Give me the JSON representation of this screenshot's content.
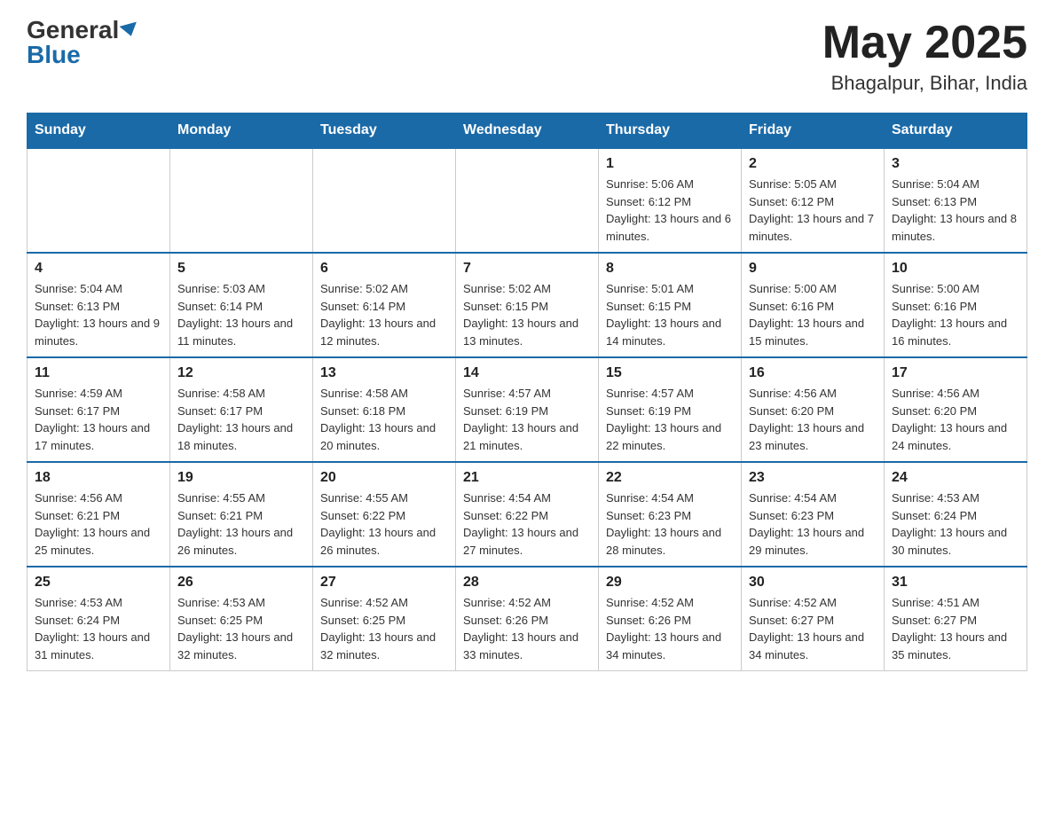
{
  "header": {
    "logo_general": "General",
    "logo_blue": "Blue",
    "month_year": "May 2025",
    "location": "Bhagalpur, Bihar, India"
  },
  "days_of_week": [
    "Sunday",
    "Monday",
    "Tuesday",
    "Wednesday",
    "Thursday",
    "Friday",
    "Saturday"
  ],
  "weeks": [
    [
      {
        "day": "",
        "info": ""
      },
      {
        "day": "",
        "info": ""
      },
      {
        "day": "",
        "info": ""
      },
      {
        "day": "",
        "info": ""
      },
      {
        "day": "1",
        "info": "Sunrise: 5:06 AM\nSunset: 6:12 PM\nDaylight: 13 hours and 6 minutes."
      },
      {
        "day": "2",
        "info": "Sunrise: 5:05 AM\nSunset: 6:12 PM\nDaylight: 13 hours and 7 minutes."
      },
      {
        "day": "3",
        "info": "Sunrise: 5:04 AM\nSunset: 6:13 PM\nDaylight: 13 hours and 8 minutes."
      }
    ],
    [
      {
        "day": "4",
        "info": "Sunrise: 5:04 AM\nSunset: 6:13 PM\nDaylight: 13 hours and 9 minutes."
      },
      {
        "day": "5",
        "info": "Sunrise: 5:03 AM\nSunset: 6:14 PM\nDaylight: 13 hours and 11 minutes."
      },
      {
        "day": "6",
        "info": "Sunrise: 5:02 AM\nSunset: 6:14 PM\nDaylight: 13 hours and 12 minutes."
      },
      {
        "day": "7",
        "info": "Sunrise: 5:02 AM\nSunset: 6:15 PM\nDaylight: 13 hours and 13 minutes."
      },
      {
        "day": "8",
        "info": "Sunrise: 5:01 AM\nSunset: 6:15 PM\nDaylight: 13 hours and 14 minutes."
      },
      {
        "day": "9",
        "info": "Sunrise: 5:00 AM\nSunset: 6:16 PM\nDaylight: 13 hours and 15 minutes."
      },
      {
        "day": "10",
        "info": "Sunrise: 5:00 AM\nSunset: 6:16 PM\nDaylight: 13 hours and 16 minutes."
      }
    ],
    [
      {
        "day": "11",
        "info": "Sunrise: 4:59 AM\nSunset: 6:17 PM\nDaylight: 13 hours and 17 minutes."
      },
      {
        "day": "12",
        "info": "Sunrise: 4:58 AM\nSunset: 6:17 PM\nDaylight: 13 hours and 18 minutes."
      },
      {
        "day": "13",
        "info": "Sunrise: 4:58 AM\nSunset: 6:18 PM\nDaylight: 13 hours and 20 minutes."
      },
      {
        "day": "14",
        "info": "Sunrise: 4:57 AM\nSunset: 6:19 PM\nDaylight: 13 hours and 21 minutes."
      },
      {
        "day": "15",
        "info": "Sunrise: 4:57 AM\nSunset: 6:19 PM\nDaylight: 13 hours and 22 minutes."
      },
      {
        "day": "16",
        "info": "Sunrise: 4:56 AM\nSunset: 6:20 PM\nDaylight: 13 hours and 23 minutes."
      },
      {
        "day": "17",
        "info": "Sunrise: 4:56 AM\nSunset: 6:20 PM\nDaylight: 13 hours and 24 minutes."
      }
    ],
    [
      {
        "day": "18",
        "info": "Sunrise: 4:56 AM\nSunset: 6:21 PM\nDaylight: 13 hours and 25 minutes."
      },
      {
        "day": "19",
        "info": "Sunrise: 4:55 AM\nSunset: 6:21 PM\nDaylight: 13 hours and 26 minutes."
      },
      {
        "day": "20",
        "info": "Sunrise: 4:55 AM\nSunset: 6:22 PM\nDaylight: 13 hours and 26 minutes."
      },
      {
        "day": "21",
        "info": "Sunrise: 4:54 AM\nSunset: 6:22 PM\nDaylight: 13 hours and 27 minutes."
      },
      {
        "day": "22",
        "info": "Sunrise: 4:54 AM\nSunset: 6:23 PM\nDaylight: 13 hours and 28 minutes."
      },
      {
        "day": "23",
        "info": "Sunrise: 4:54 AM\nSunset: 6:23 PM\nDaylight: 13 hours and 29 minutes."
      },
      {
        "day": "24",
        "info": "Sunrise: 4:53 AM\nSunset: 6:24 PM\nDaylight: 13 hours and 30 minutes."
      }
    ],
    [
      {
        "day": "25",
        "info": "Sunrise: 4:53 AM\nSunset: 6:24 PM\nDaylight: 13 hours and 31 minutes."
      },
      {
        "day": "26",
        "info": "Sunrise: 4:53 AM\nSunset: 6:25 PM\nDaylight: 13 hours and 32 minutes."
      },
      {
        "day": "27",
        "info": "Sunrise: 4:52 AM\nSunset: 6:25 PM\nDaylight: 13 hours and 32 minutes."
      },
      {
        "day": "28",
        "info": "Sunrise: 4:52 AM\nSunset: 6:26 PM\nDaylight: 13 hours and 33 minutes."
      },
      {
        "day": "29",
        "info": "Sunrise: 4:52 AM\nSunset: 6:26 PM\nDaylight: 13 hours and 34 minutes."
      },
      {
        "day": "30",
        "info": "Sunrise: 4:52 AM\nSunset: 6:27 PM\nDaylight: 13 hours and 34 minutes."
      },
      {
        "day": "31",
        "info": "Sunrise: 4:51 AM\nSunset: 6:27 PM\nDaylight: 13 hours and 35 minutes."
      }
    ]
  ]
}
